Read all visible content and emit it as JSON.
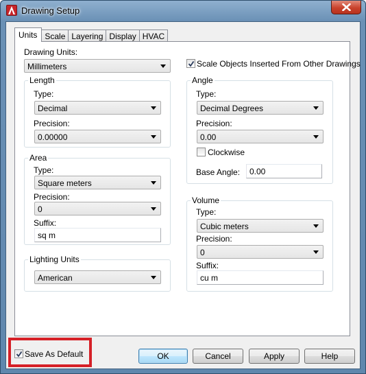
{
  "window": {
    "title": "Drawing Setup",
    "icon": "autocad-a-icon",
    "close_icon": "close-x-icon"
  },
  "tabs": [
    {
      "label": "Units",
      "active": true
    },
    {
      "label": "Scale",
      "active": false
    },
    {
      "label": "Layering",
      "active": false
    },
    {
      "label": "Display",
      "active": false
    },
    {
      "label": "HVAC",
      "active": false
    }
  ],
  "drawing_units": {
    "label": "Drawing Units:",
    "value": "Millimeters"
  },
  "scale_objects": {
    "label": "Scale Objects Inserted From Other Drawings",
    "checked": true
  },
  "length": {
    "title": "Length",
    "type_label": "Type:",
    "type_value": "Decimal",
    "precision_label": "Precision:",
    "precision_value": "0.00000"
  },
  "area": {
    "title": "Area",
    "type_label": "Type:",
    "type_value": "Square meters",
    "precision_label": "Precision:",
    "precision_value": "0",
    "suffix_label": "Suffix:",
    "suffix_value": "sq m"
  },
  "lighting": {
    "title": "Lighting Units",
    "value": "American"
  },
  "angle": {
    "title": "Angle",
    "type_label": "Type:",
    "type_value": "Decimal Degrees",
    "precision_label": "Precision:",
    "precision_value": "0.00",
    "clockwise_label": "Clockwise",
    "clockwise_checked": false,
    "base_angle_label": "Base Angle:",
    "base_angle_value": "0.00"
  },
  "volume": {
    "title": "Volume",
    "type_label": "Type:",
    "type_value": "Cubic meters",
    "precision_label": "Precision:",
    "precision_value": "0",
    "suffix_label": "Suffix:",
    "suffix_value": "cu m"
  },
  "footer": {
    "save_default_label": "Save As Default",
    "save_default_checked": true,
    "ok_label": "OK",
    "cancel_label": "Cancel",
    "apply_label": "Apply",
    "help_label": "Help"
  },
  "colors": {
    "highlight_border": "#d52027",
    "title_bar": "#6a90b5",
    "close_button": "#c9422c"
  }
}
